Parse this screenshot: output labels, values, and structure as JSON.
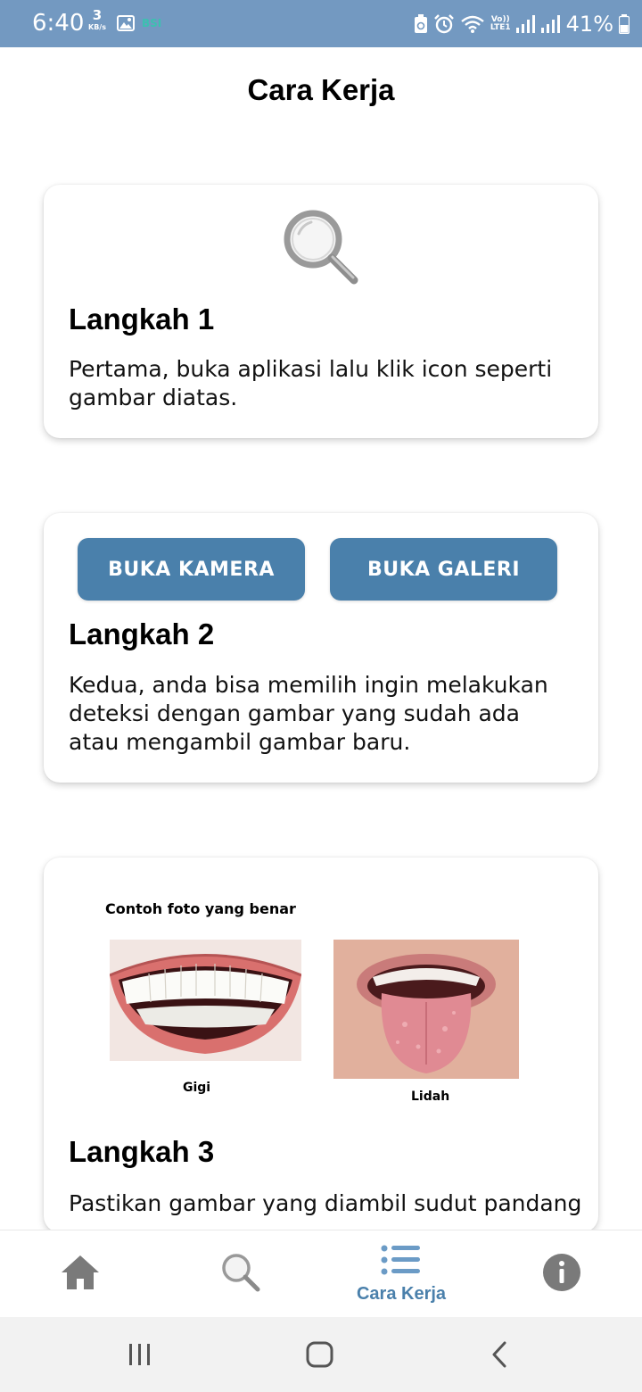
{
  "status_bar": {
    "time": "6:40",
    "net_speed_value": "3",
    "net_speed_unit": "KB/s",
    "carrier_badge": "BSI",
    "volte_top": "Vo))",
    "volte_bottom": "LTE1",
    "battery_percent": "41%"
  },
  "header": {
    "title": "Cara Kerja"
  },
  "steps": [
    {
      "title": "Langkah 1",
      "description": "Pertama, buka aplikasi lalu klik icon seperti gambar diatas.",
      "icon": "magnifier-icon"
    },
    {
      "title": "Langkah 2",
      "description": "Kedua, anda bisa memilih ingin melakukan deteksi dengan gambar yang sudah ada atau mengambil gambar baru.",
      "buttons": [
        "BUKA KAMERA",
        "BUKA GALERI"
      ]
    },
    {
      "title": "Langkah 3",
      "description": "Pastikan gambar yang diambil sudut pandang",
      "example_heading": "Contoh foto yang benar",
      "examples": [
        "Gigi",
        "Lidah"
      ]
    }
  ],
  "bottom_nav": {
    "items": [
      {
        "icon": "home-icon",
        "label": ""
      },
      {
        "icon": "search-icon",
        "label": ""
      },
      {
        "icon": "list-icon",
        "label": "Cara Kerja",
        "active": true
      },
      {
        "icon": "info-icon",
        "label": ""
      }
    ],
    "active_color": "#4a80ab",
    "inactive_color": "#777777"
  },
  "colors": {
    "status_bar": "#7399c1",
    "accent": "#4a80ab",
    "system_nav": "#f2f2f2"
  }
}
